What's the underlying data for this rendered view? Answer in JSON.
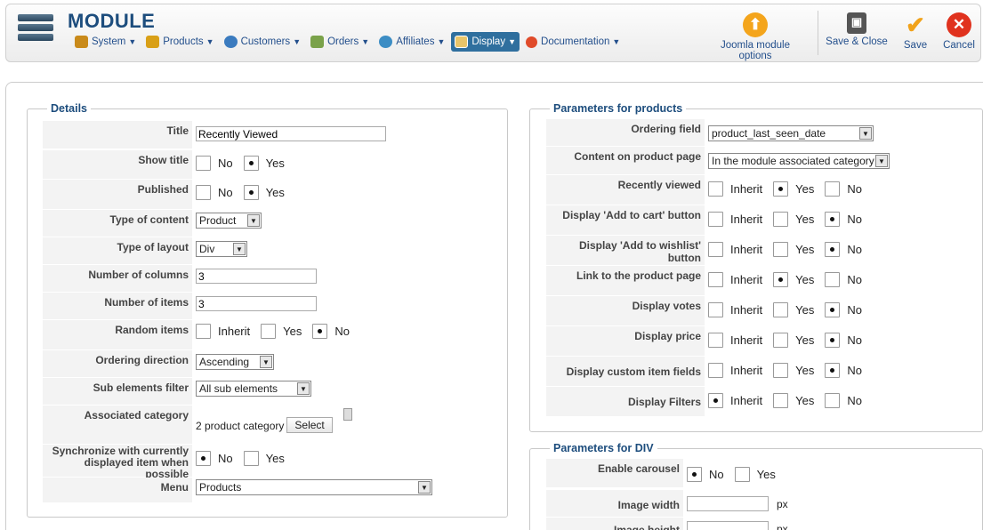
{
  "header": {
    "title": "MODULE",
    "menu": [
      {
        "label": "System",
        "icon": "tools-icon",
        "color": "#c98a1a"
      },
      {
        "label": "Products",
        "icon": "products-icon",
        "color": "#d9a017"
      },
      {
        "label": "Customers",
        "icon": "customers-icon",
        "color": "#3b7bbf"
      },
      {
        "label": "Orders",
        "icon": "orders-icon",
        "color": "#7aa24a"
      },
      {
        "label": "Affiliates",
        "icon": "affiliates-icon",
        "color": "#3c8dc4"
      },
      {
        "label": "Display",
        "icon": "display-icon",
        "color": "#e8c56a"
      },
      {
        "label": "Documentation",
        "icon": "lifebuoy-icon",
        "color": "#e04b2a"
      }
    ],
    "toolbar": {
      "options_label": "Joomla module options",
      "save_close_label": "Save & Close",
      "save_label": "Save",
      "cancel_label": "Cancel"
    }
  },
  "details": {
    "legend": "Details",
    "title_label": "Title",
    "title_value": "Recently Viewed",
    "show_title_label": "Show title",
    "published_label": "Published",
    "type_content_label": "Type of content",
    "type_content_value": "Product",
    "type_layout_label": "Type of layout",
    "type_layout_value": "Div",
    "num_columns_label": "Number of columns",
    "num_columns_value": "3",
    "num_items_label": "Number of items",
    "num_items_value": "3",
    "random_items_label": "Random items",
    "ordering_dir_label": "Ordering direction",
    "ordering_dir_value": "Ascending",
    "sub_filter_label": "Sub elements filter",
    "sub_filter_value": "All sub elements",
    "assoc_cat_label": "Associated category",
    "assoc_cat_value": "2 product category",
    "select_label": "Select",
    "sync_label_1": "Synchronize with currently",
    "sync_label_2": "displayed item when possible",
    "menu_label": "Menu",
    "menu_value": "Products"
  },
  "params_products": {
    "legend": "Parameters for products",
    "ordering_field_label": "Ordering field",
    "ordering_field_value": "product_last_seen_date",
    "content_page_label": "Content on product page",
    "content_page_value": "In the module associated category",
    "recently_viewed_label": "Recently viewed",
    "add_cart_label": "Display 'Add to cart' button",
    "add_wishlist_label": "Display 'Add to wishlist' button",
    "link_page_label": "Link to the product page",
    "votes_label": "Display votes",
    "price_label": "Display price",
    "custom_fields_label": "Display custom item fields",
    "filters_label": "Display Filters"
  },
  "params_div": {
    "legend": "Parameters for DIV",
    "carousel_label": "Enable carousel",
    "image_width_label": "Image width",
    "image_height_label": "Image height",
    "px": "px"
  },
  "opts": {
    "no": "No",
    "yes": "Yes",
    "inherit": "Inherit"
  }
}
